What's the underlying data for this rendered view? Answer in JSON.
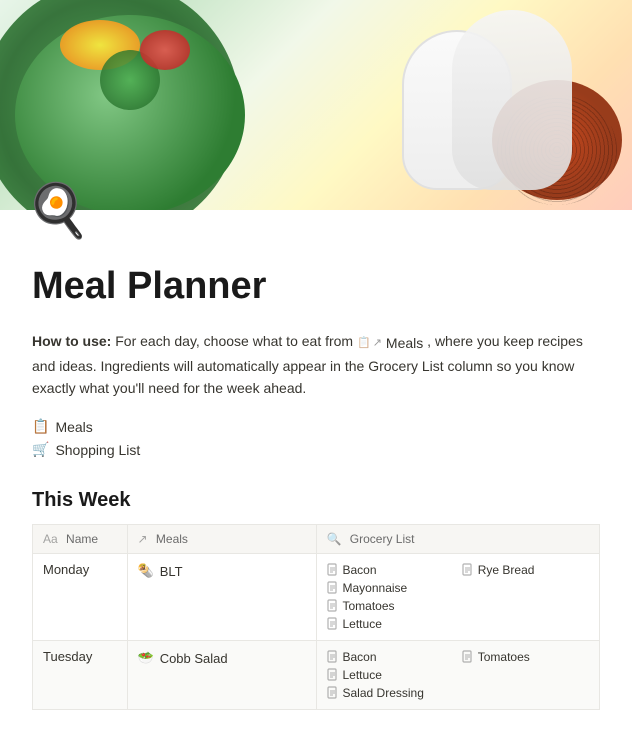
{
  "hero": {
    "alt": "Meal planner hero food image"
  },
  "page": {
    "icon": "🍳",
    "title": "Meal Planner",
    "how_to_use_label": "How to use:",
    "how_to_use_text": " For each day, choose what to eat from ",
    "meals_link": "Meals",
    "how_to_use_text2": ", where you keep recipes and ideas. Ingredients will automatically appear in the Grocery List column so you know exactly what you'll need for the week ahead."
  },
  "nav": {
    "meals_icon": "📋",
    "meals_label": "Meals",
    "shopping_icon": "🛒",
    "shopping_label": "Shopping List"
  },
  "this_week": {
    "title": "This Week"
  },
  "table": {
    "headers": [
      {
        "icon": "Aa",
        "label": "Name"
      },
      {
        "icon": "↗",
        "label": "Meals"
      },
      {
        "icon": "🔍",
        "label": "Grocery List"
      }
    ],
    "rows": [
      {
        "day": "Monday",
        "meal_emoji": "🌯",
        "meal": "BLT",
        "groceries": [
          {
            "col": 1,
            "name": "Bacon"
          },
          {
            "col": 2,
            "name": "Rye Bread"
          },
          {
            "col": 1,
            "name": "Mayonnaise"
          },
          {
            "col": 1,
            "name": "Tomatoes"
          },
          {
            "col": 1,
            "name": "Lettuce"
          }
        ]
      },
      {
        "day": "Tuesday",
        "meal_emoji": "🥗",
        "meal": "Cobb Salad",
        "groceries": [
          {
            "col": 1,
            "name": "Bacon"
          },
          {
            "col": 2,
            "name": "Tomatoes"
          },
          {
            "col": 1,
            "name": "Lettuce"
          },
          {
            "col": 1,
            "name": "Salad Dressing"
          }
        ]
      }
    ]
  }
}
